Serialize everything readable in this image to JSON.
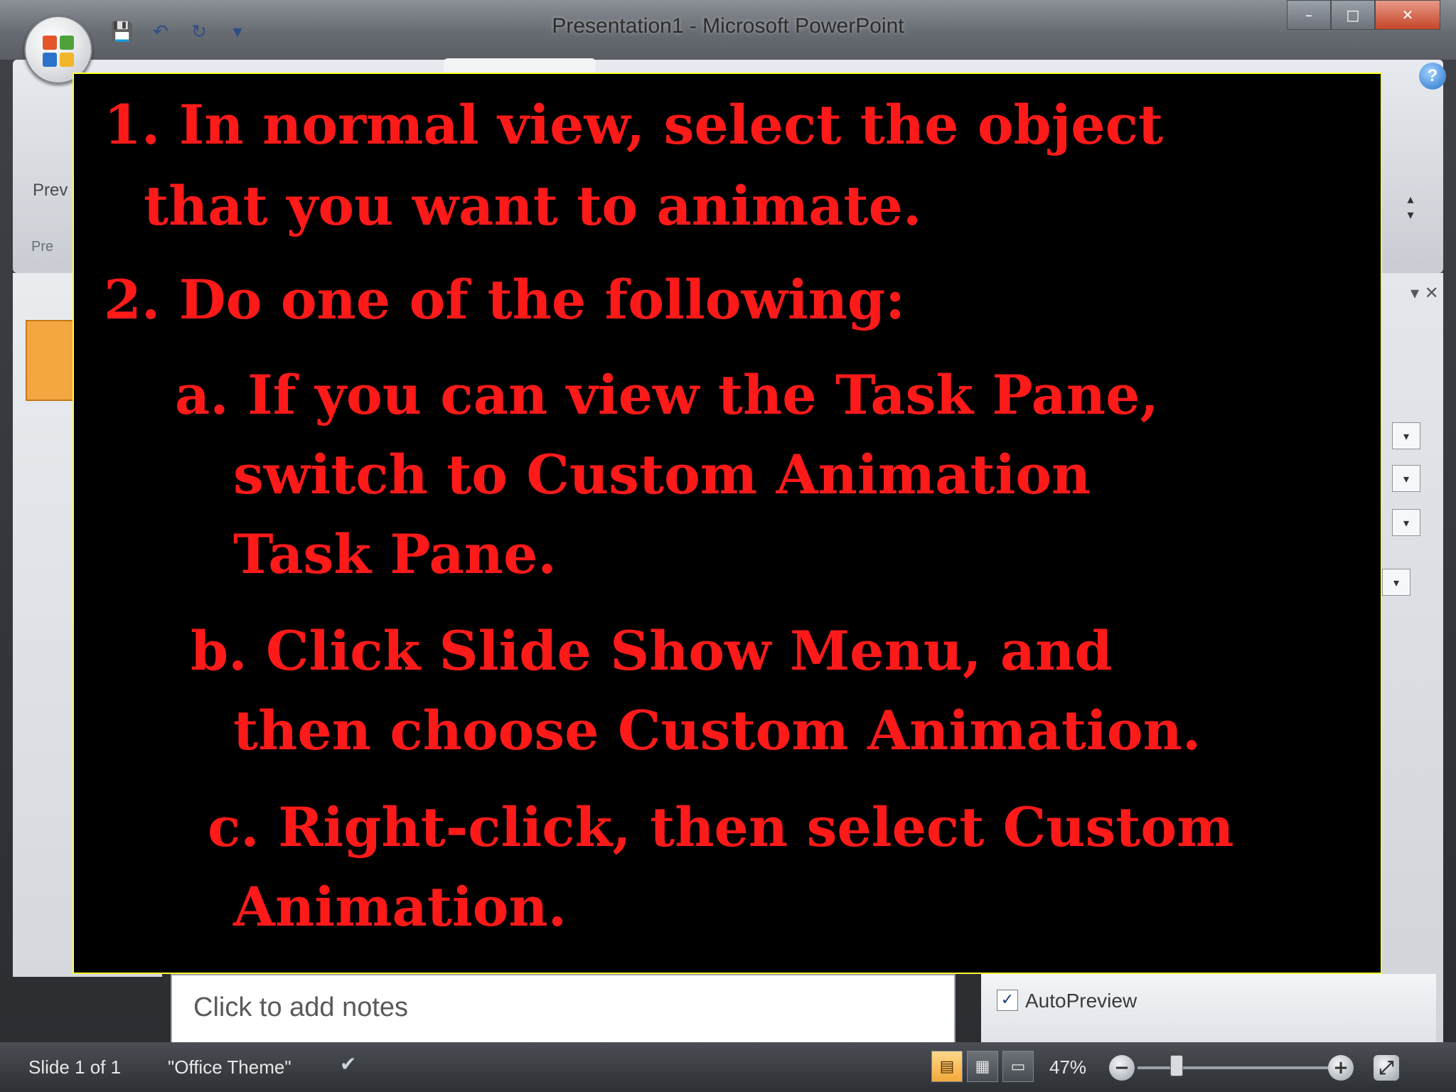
{
  "window": {
    "title": "Presentation1 - Microsoft PowerPoint",
    "controls": {
      "minimize": "–",
      "maximize": "□",
      "close": "✕"
    },
    "help_icon": "?"
  },
  "quick_access": {
    "icons": [
      "save-icon",
      "undo-icon",
      "redo-icon",
      "customize-icon"
    ]
  },
  "ribbon": {
    "preview_label": "Prev",
    "group_label": "Pre"
  },
  "task_pane": {
    "autopreview_checked": true,
    "autopreview_label": "AutoPreview"
  },
  "notes": {
    "placeholder": "Click to add notes"
  },
  "statusbar": {
    "slide_info": "Slide 1 of 1",
    "theme": "\"Office Theme\"",
    "zoom_percent": "47%"
  },
  "slide": {
    "text_color": "#ff1a1a",
    "border_color": "#ffff33",
    "lines": [
      "1. In normal view, select the object",
      "that you want to animate.",
      "2. Do one of the following:",
      "a. If you can view the Task Pane,",
      "switch to Custom Animation",
      "Task Pane.",
      "b. Click Slide Show Menu, and",
      "then choose Custom Animation.",
      "c. Right-click, then select Custom",
      "Animation."
    ]
  }
}
